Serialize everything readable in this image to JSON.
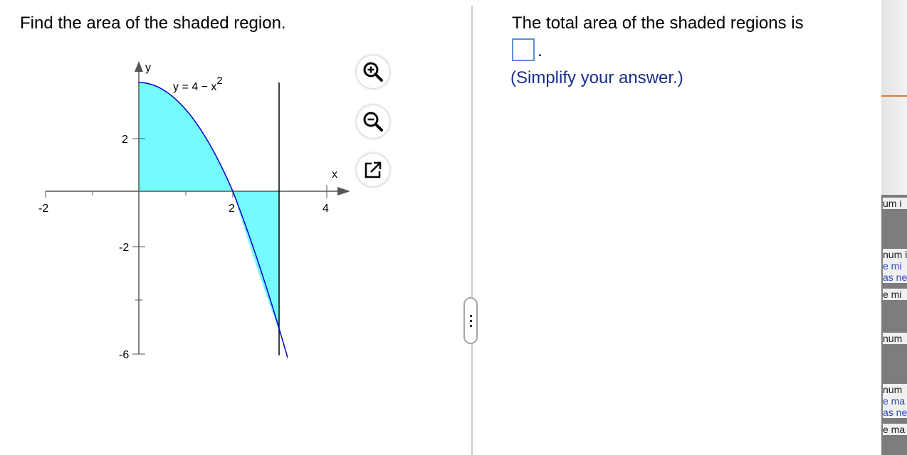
{
  "question": {
    "text": "Find the area of the shaded region."
  },
  "graph": {
    "curve_label": "y = 4 − x",
    "curve_label_exp": "2",
    "x_axis_label": "x",
    "y_axis_label": "y",
    "x_ticks": [
      "-2",
      "2",
      "4"
    ],
    "y_ticks": [
      "2",
      "-2",
      "-6"
    ],
    "colors": {
      "shade": "#74fbfe",
      "curve": "#0000cc",
      "axis": "#555555"
    }
  },
  "tools": {
    "zoom_in_icon": "zoom-in-icon",
    "zoom_out_icon": "zoom-out-icon",
    "popout_icon": "popout-icon"
  },
  "answer": {
    "title": "The total area of the shaded regions is",
    "value": "",
    "period": ".",
    "hint": "(Simplify your answer.)"
  },
  "side_panel": {
    "fragments": [
      "um i",
      "num i",
      "e mi",
      "as ne",
      "e mi",
      "num",
      "num",
      "e ma",
      "as ne",
      "e ma"
    ]
  }
}
